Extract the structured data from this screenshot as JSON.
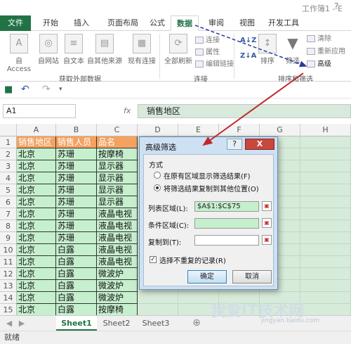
{
  "window": {
    "workbook_title": "工作簿1 - E",
    "controls": "?"
  },
  "tabs": [
    {
      "label": "文件"
    },
    {
      "label": "开始"
    },
    {
      "label": "插入"
    },
    {
      "label": "页面布局"
    },
    {
      "label": "公式"
    },
    {
      "label": "数据"
    },
    {
      "label": "审阅"
    },
    {
      "label": "视图"
    },
    {
      "label": "开发工具"
    }
  ],
  "ribbon": {
    "external_group": {
      "label": "获取外部数据",
      "buttons": [
        "自 Access",
        "自网站",
        "自文本",
        "自其他来源",
        "现有连接"
      ]
    },
    "refresh": {
      "label": "全部刷新"
    },
    "connections_group": {
      "label": "连接",
      "items": [
        "连接",
        "属性",
        "编辑链接"
      ]
    },
    "sort_group": {
      "label": "排序和筛选",
      "az": "A↓Z",
      "za": "Z↓A",
      "sort": "排序",
      "filter": "筛选",
      "items": [
        "清除",
        "重新应用",
        "高级"
      ]
    }
  },
  "formula_bar": {
    "name_box": "A1",
    "fx": "fx",
    "value": "销售地区"
  },
  "grid": {
    "columns": [
      "A",
      "B",
      "C",
      "D",
      "E",
      "F",
      "G",
      "H"
    ],
    "rows": [
      [
        "销售地区",
        "销售人员",
        "品名"
      ],
      [
        "北京",
        "苏珊",
        "按摩椅"
      ],
      [
        "北京",
        "苏珊",
        "显示器"
      ],
      [
        "北京",
        "苏珊",
        "显示器"
      ],
      [
        "北京",
        "苏珊",
        "显示器"
      ],
      [
        "北京",
        "苏珊",
        "显示器"
      ],
      [
        "北京",
        "苏珊",
        "液晶电视"
      ],
      [
        "北京",
        "苏珊",
        "液晶电视"
      ],
      [
        "北京",
        "苏珊",
        "液晶电视"
      ],
      [
        "北京",
        "白露",
        "液晶电视"
      ],
      [
        "北京",
        "白露",
        "液晶电视"
      ],
      [
        "北京",
        "白露",
        "微波炉"
      ],
      [
        "北京",
        "白露",
        "微波炉"
      ],
      [
        "北京",
        "白露",
        "微波炉"
      ],
      [
        "北京",
        "白露",
        "按摩椅"
      ]
    ],
    "row_numbers": [
      "1",
      "2",
      "3",
      "4",
      "5",
      "6",
      "7",
      "8",
      "9",
      "10",
      "11",
      "12",
      "13",
      "14",
      "15"
    ]
  },
  "dialog": {
    "title": "高级筛选",
    "help": "?",
    "close": "X",
    "section": "方式",
    "option1": "在原有区域显示筛选结果(F)",
    "option2": "将筛选结果复制到其他位置(O)",
    "list_range_label": "列表区域(L):",
    "list_range_value": "$A$1:$C$75",
    "criteria_label": "条件区域(C):",
    "copy_to_label": "复制到(T):",
    "unique_label": "选择不重复的记录(R)",
    "ok": "确定",
    "cancel": "取消"
  },
  "sheets": [
    "Sheet1",
    "Sheet2",
    "Sheet3"
  ],
  "status": "就绪",
  "watermark": {
    "main": "我爱IT技术网",
    "sub": "jingyan.baidu.com"
  },
  "colors": {
    "excel_green": "#217346",
    "header_orange": "#f4a260",
    "data_green": "#c6efce",
    "arrow_red": "#c0282d",
    "arrow_blue": "#2a3a9c"
  }
}
